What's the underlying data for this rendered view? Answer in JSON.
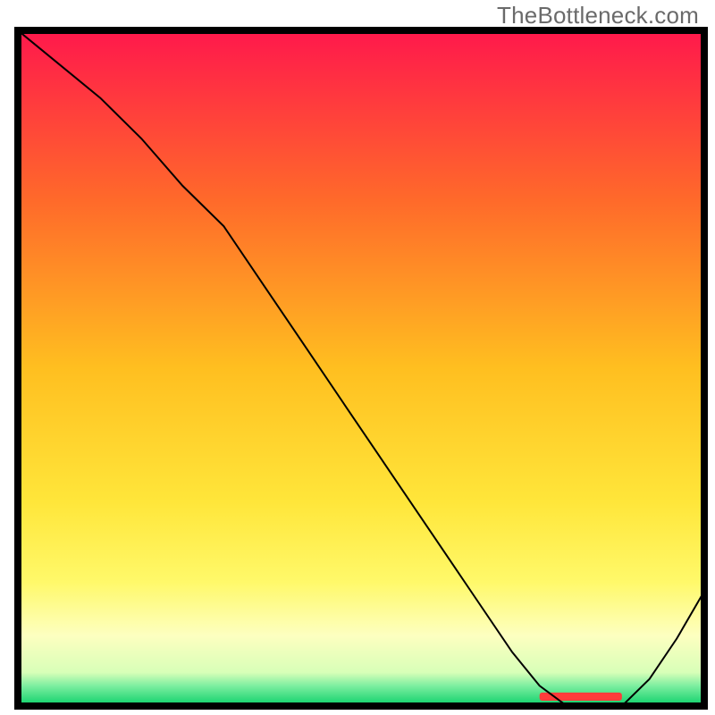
{
  "watermark": "TheBottleneck.com",
  "chart_data": {
    "type": "line",
    "title": "",
    "xlabel": "",
    "ylabel": "",
    "xlim": [
      0,
      100
    ],
    "ylim": [
      0,
      100
    ],
    "legend": false,
    "grid": false,
    "background_gradient": {
      "stops": [
        {
          "offset": 0.0,
          "color": "#ff1a4b"
        },
        {
          "offset": 0.25,
          "color": "#ff6a2a"
        },
        {
          "offset": 0.5,
          "color": "#ffbf20"
        },
        {
          "offset": 0.7,
          "color": "#ffe63a"
        },
        {
          "offset": 0.82,
          "color": "#fff96a"
        },
        {
          "offset": 0.9,
          "color": "#fdffc0"
        },
        {
          "offset": 0.955,
          "color": "#d8ffb8"
        },
        {
          "offset": 0.975,
          "color": "#7deea0"
        },
        {
          "offset": 1.0,
          "color": "#1fd573"
        }
      ]
    },
    "series": [
      {
        "name": "bottleneck-curve",
        "color": "#000000",
        "stroke_width": 2,
        "x": [
          0,
          6,
          12,
          18,
          24,
          30,
          36,
          42,
          48,
          54,
          60,
          66,
          72,
          76,
          80,
          84,
          88,
          92,
          96,
          100
        ],
        "y": [
          100,
          95,
          90,
          84,
          77,
          71,
          62,
          53,
          44,
          35,
          26,
          17,
          8,
          3,
          0,
          0,
          0,
          4,
          10,
          17
        ]
      }
    ],
    "marker": {
      "name": "optimum-band",
      "color": "#ff3b3b",
      "x_start": 76,
      "x_end": 88,
      "y": 0,
      "height_pct": 1.2
    }
  }
}
